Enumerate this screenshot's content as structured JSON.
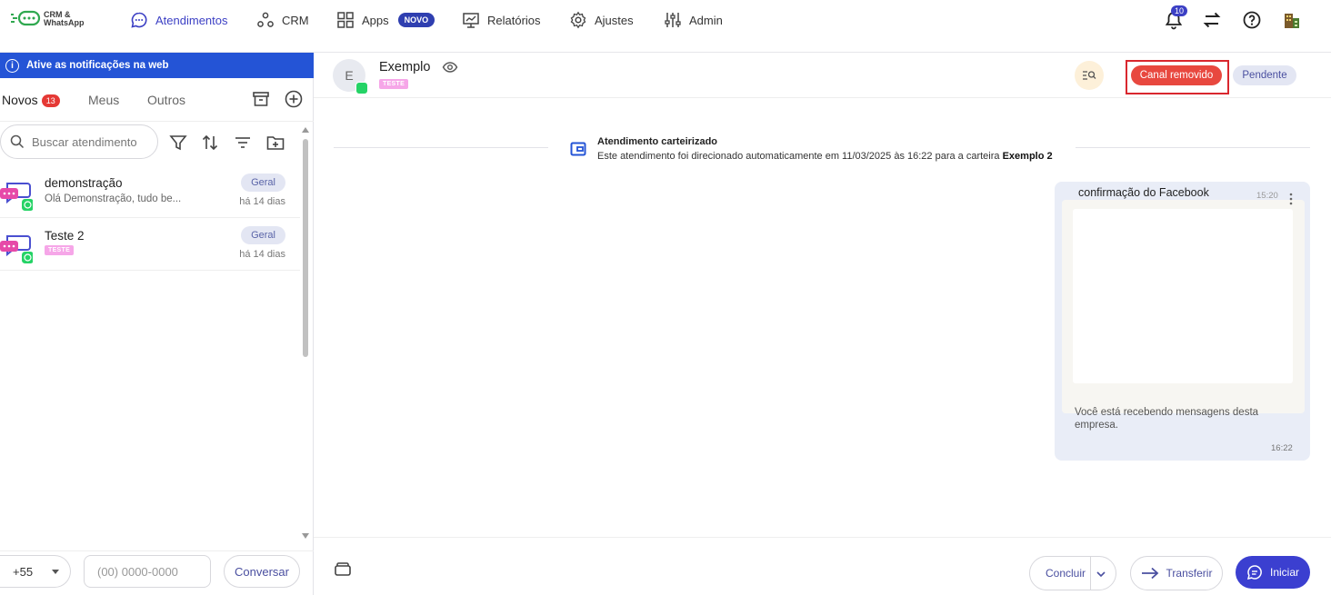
{
  "app": {
    "logo_text_line1": "CRM &",
    "logo_text_line2": "WhatsApp"
  },
  "nav": {
    "items": [
      {
        "label": "Atendimentos",
        "icon": "chat-bubble-icon",
        "active": true
      },
      {
        "label": "CRM",
        "icon": "crm-nodes-icon",
        "active": false
      },
      {
        "label": "Apps",
        "icon": "apps-grid-icon",
        "active": false,
        "badge": "NOVO"
      },
      {
        "label": "Relatórios",
        "icon": "chart-board-icon",
        "active": false
      },
      {
        "label": "Ajustes",
        "icon": "gear-icon",
        "active": false
      },
      {
        "label": "Admin",
        "icon": "sliders-icon",
        "active": false
      }
    ],
    "notification_count": "10",
    "colors": {
      "accent": "#3b3fc4",
      "badge": "#2f3fb0"
    }
  },
  "sidebar": {
    "notification_banner": "Ative as notificações na web",
    "tabs": [
      {
        "label": "Novos",
        "count": "13",
        "active": true
      },
      {
        "label": "Meus",
        "active": false
      },
      {
        "label": "Outros",
        "active": false
      }
    ],
    "search_placeholder": "Buscar atendimento",
    "conversations": [
      {
        "name": "demonstração",
        "preview": "Olá Demonstração, tudo be...",
        "group": "Geral",
        "time": "há 14 dias"
      },
      {
        "name": "Teste 2",
        "tag": "TESTE",
        "group": "Geral",
        "time": "há 14 dias"
      }
    ],
    "footer": {
      "country_code": "+55",
      "phone_placeholder": "(00) 0000-0000",
      "start_button": "Conversar"
    }
  },
  "chat": {
    "contact_initial": "E",
    "contact_name": "Exemplo",
    "contact_tag": "TESTE",
    "status_removed": "Canal removido",
    "status_pending": "Pendente",
    "system_event": {
      "title": "Atendimento carteirizado",
      "text": "Este atendimento foi direcionado automaticamente em 11/03/2025 às 16:22 para a carteira",
      "wallet": "Exemplo 2"
    },
    "message": {
      "header": "confirmação do Facebook",
      "time_header": "15:20",
      "footer_text": "Você está recebendo mensagens desta empresa.",
      "time": "16:22"
    },
    "actions": {
      "conclude": "Concluir",
      "transfer": "Transferir",
      "start": "Iniciar"
    },
    "colors": {
      "removed": "#e8483f",
      "highlight_frame": "#d9272e",
      "primary": "#3b3fd0"
    }
  }
}
